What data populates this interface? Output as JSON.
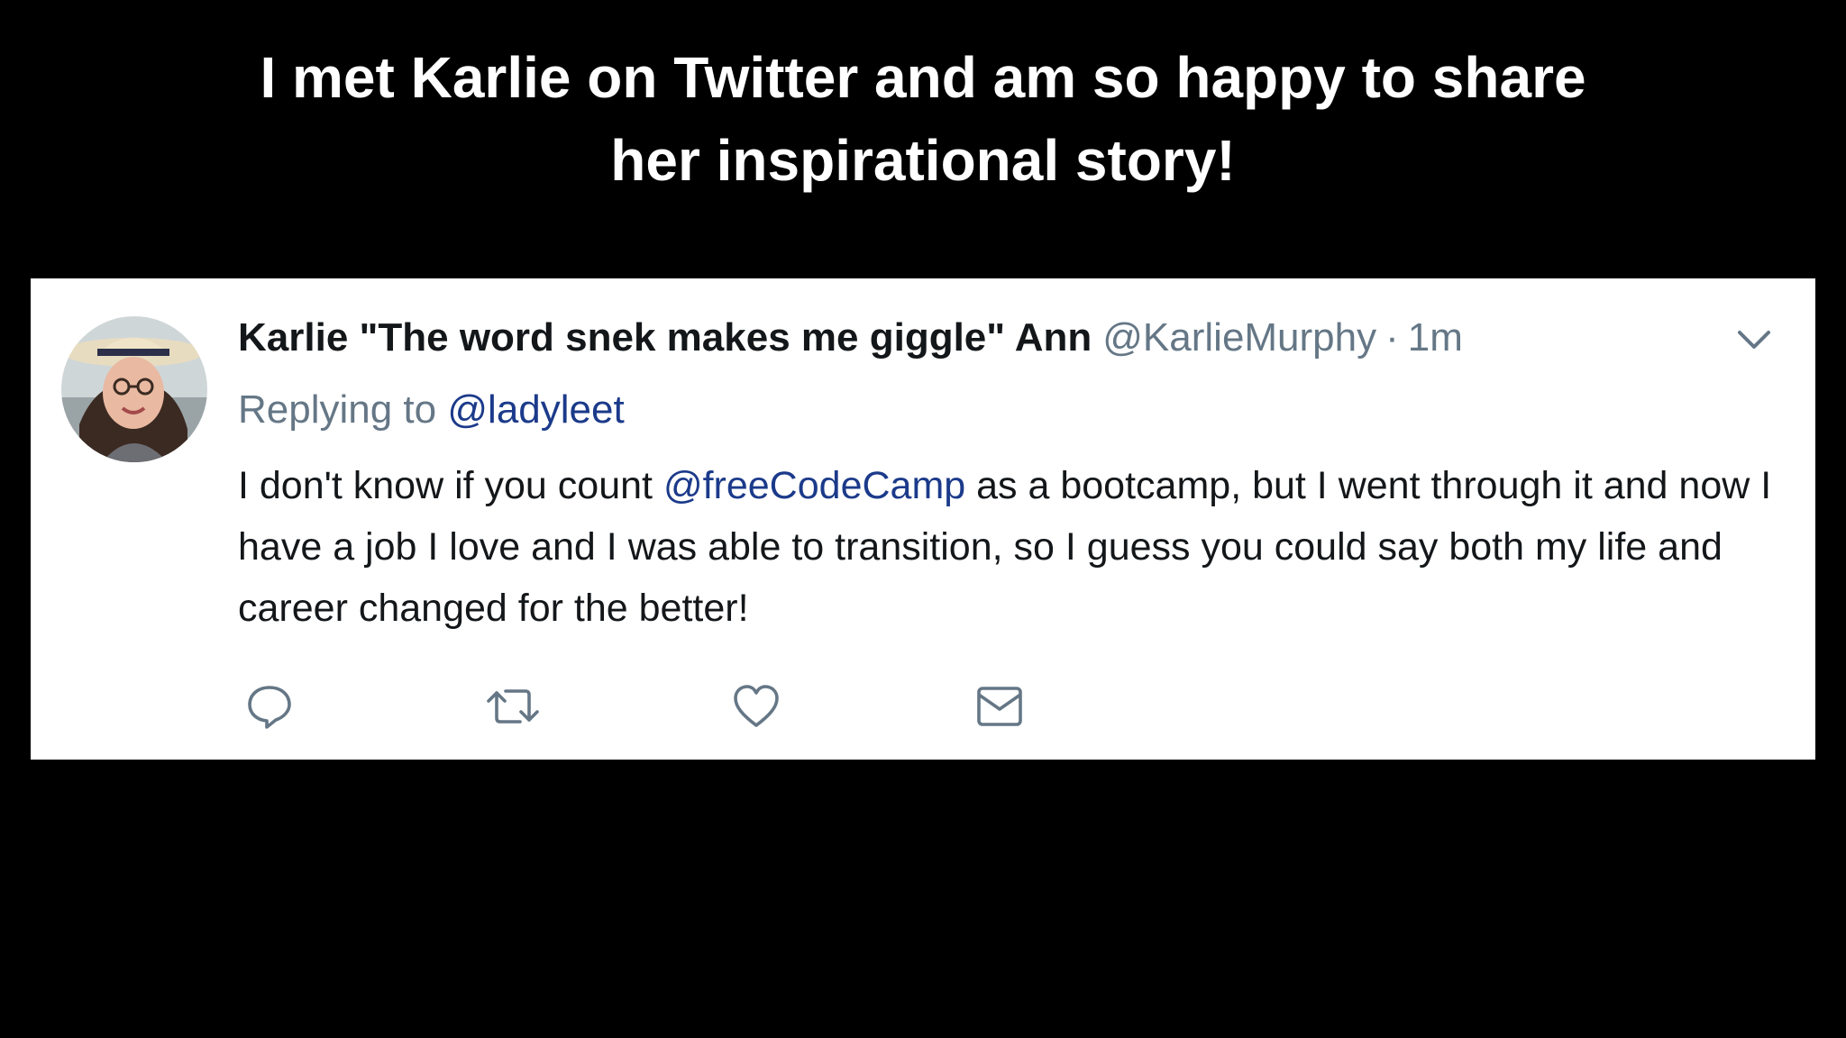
{
  "headline": {
    "line1": "I met Karlie on Twitter and am so happy to share",
    "line2": "her inspirational story!"
  },
  "tweet": {
    "author_name": "Karlie \"The word snek makes me giggle\" Ann",
    "author_handle": "@KarlieMurphy",
    "separator": "·",
    "timestamp": "1m",
    "replying_prefix": "Replying to",
    "replying_handle": "@ladyleet",
    "text_before_mention": "I don't know if you count ",
    "mention": "@freeCodeCamp",
    "text_after_mention": " as a bootcamp, but I went through it and now I have a job I love and I was able to transition, so I guess you could say both my life and career changed for the better!",
    "actions": [
      "reply-icon",
      "retweet-icon",
      "like-icon",
      "direct-message-icon"
    ],
    "icons": {
      "menu": "chevron-down-icon",
      "avatar": "avatar"
    }
  },
  "colors": {
    "background": "#000000",
    "card": "#ffffff",
    "text": "#14171a",
    "muted": "#657786",
    "link": "#1b3a8a"
  }
}
